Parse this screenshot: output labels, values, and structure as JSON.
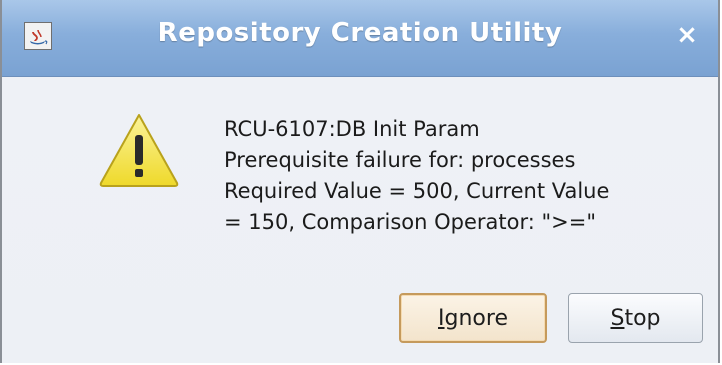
{
  "window": {
    "title": "Repository Creation Utility",
    "close_glyph": "×",
    "app_icon": "java-app-icon"
  },
  "dialog": {
    "icon": "warning-icon",
    "message_lines": [
      "RCU-6107:DB Init Param",
      "Prerequisite failure for: processes",
      "Required Value = 500, Current Value",
      "= 150, Comparison Operator: \">=\""
    ]
  },
  "buttons": {
    "ignore": {
      "mnemonic": "I",
      "rest": "gnore"
    },
    "stop": {
      "mnemonic": "S",
      "rest": "top"
    }
  },
  "colors": {
    "titlebar": "#88aedb",
    "warning_fill": "#f4e84b",
    "default_button_border": "#c59a5c"
  }
}
